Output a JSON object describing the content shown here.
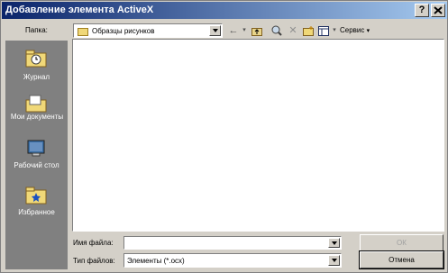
{
  "dialog": {
    "title": "Добавление элемента ActiveX",
    "help_btn": "?",
    "close_btn": "X"
  },
  "toolbar": {
    "folder_label": "Папка:",
    "folder_value": "Образцы рисунков",
    "back_icon": "back-arrow-icon",
    "tools_label": "Сервис"
  },
  "places": [
    {
      "label": "Журнал",
      "icon": "history-icon"
    },
    {
      "label": "Мои документы",
      "icon": "my-documents-icon"
    },
    {
      "label": "Рабочий стол",
      "icon": "desktop-icon"
    },
    {
      "label": "Избранное",
      "icon": "favorites-icon"
    }
  ],
  "form": {
    "filename_label": "Имя файла:",
    "filename_value": "",
    "filetype_label": "Тип файлов:",
    "filetype_value": "Элементы (*.ocx)",
    "ok_label": "ОК",
    "cancel_label": "Отмена"
  },
  "colors": {
    "titlebar_start": "#0a246a",
    "titlebar_end": "#a6caf0",
    "face": "#d4d0c8",
    "places_bar": "#808080"
  }
}
